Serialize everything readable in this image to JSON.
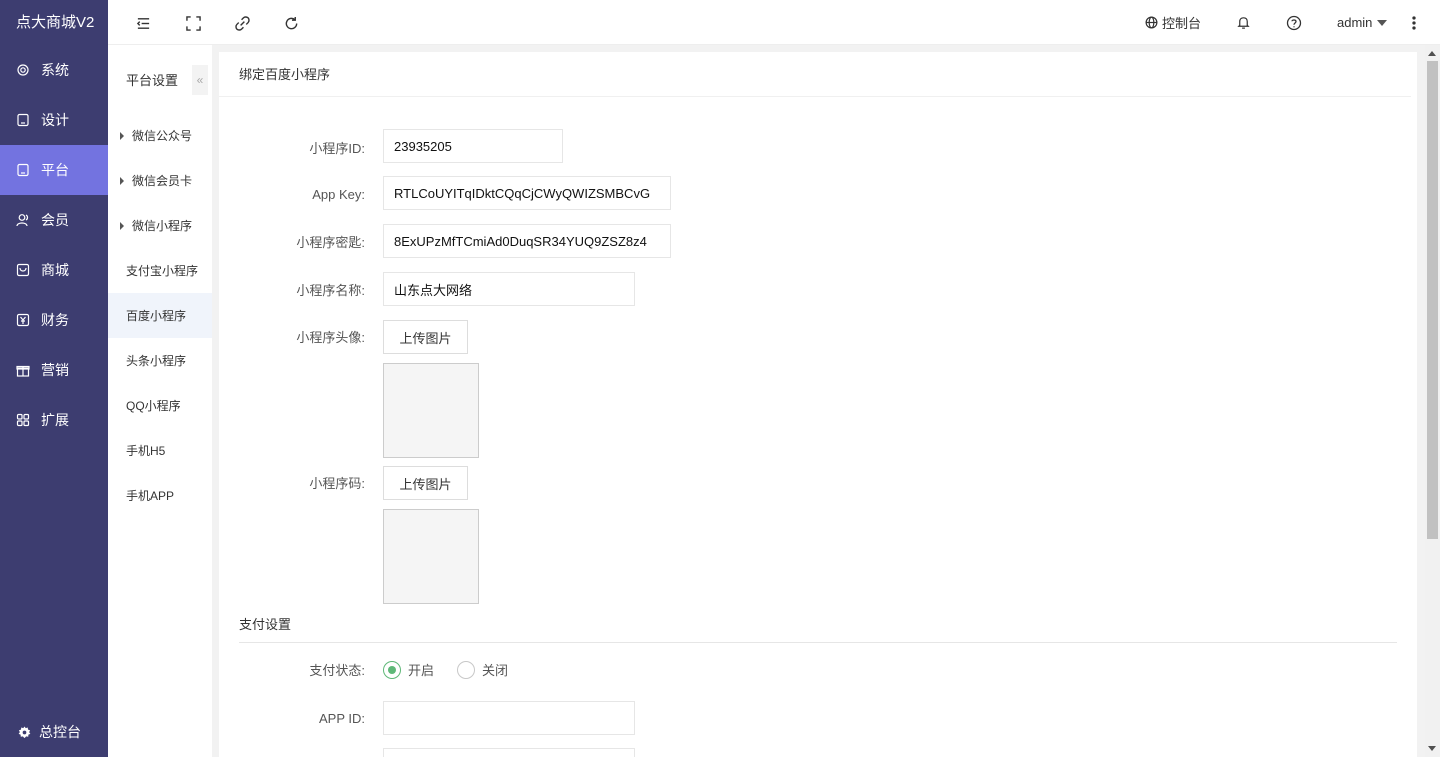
{
  "brand": "点大商城V2",
  "sidebar": {
    "items": [
      {
        "label": "系统",
        "icon": "gear-icon"
      },
      {
        "label": "设计",
        "icon": "tablet-icon"
      },
      {
        "label": "平台",
        "icon": "tablet-icon",
        "active": true
      },
      {
        "label": "会员",
        "icon": "user-icon"
      },
      {
        "label": "商城",
        "icon": "shop-icon"
      },
      {
        "label": "财务",
        "icon": "yen-icon"
      },
      {
        "label": "营销",
        "icon": "gift-icon"
      },
      {
        "label": "扩展",
        "icon": "grid-icon"
      }
    ],
    "footer": "总控台"
  },
  "topbar": {
    "console": "控制台",
    "user": "admin"
  },
  "subnav": {
    "title": "平台设置",
    "collapse": "«",
    "items": [
      {
        "label": "微信公众号",
        "expandable": true
      },
      {
        "label": "微信会员卡",
        "expandable": true
      },
      {
        "label": "微信小程序",
        "expandable": true
      },
      {
        "label": "支付宝小程序"
      },
      {
        "label": "百度小程序",
        "active": true
      },
      {
        "label": "头条小程序"
      },
      {
        "label": "QQ小程序"
      },
      {
        "label": "手机H5"
      },
      {
        "label": "手机APP"
      }
    ]
  },
  "form": {
    "header": "绑定百度小程序",
    "appid_label": "小程序ID:",
    "appid_value": "23935205",
    "appkey_label": "App Key:",
    "appkey_value": "RTLCoUYITqIDktCQqCjCWyQWIZSMBCvG",
    "secret_label": "小程序密匙:",
    "secret_value": "8ExUPzMfTCmiAd0DuqSR34YUQ9ZSZ8z4",
    "name_label": "小程序名称:",
    "name_value": "山东点大网络",
    "avatar_label": "小程序头像:",
    "upload_label": "上传图片",
    "qrcode_label": "小程序码:"
  },
  "payment": {
    "title": "支付设置",
    "status_label": "支付状态:",
    "on_label": "开启",
    "off_label": "关闭",
    "appid_label": "APP ID:",
    "appid_value": ""
  },
  "colors": {
    "sidebar": "#3d3d70",
    "active": "#7373e0",
    "radio": "#5fb878"
  }
}
